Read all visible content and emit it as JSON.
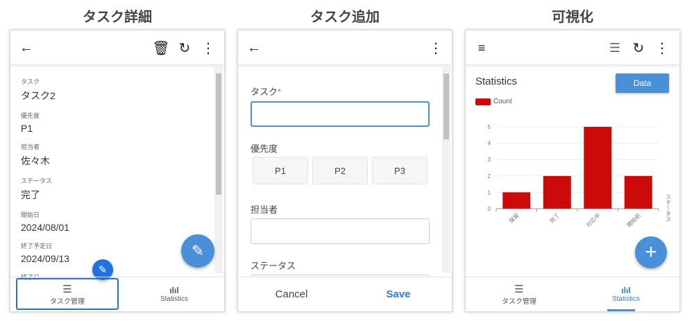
{
  "titles": [
    "タスク詳細",
    "タスク追加",
    "可視化"
  ],
  "detail": {
    "fields": [
      {
        "label": "タスク",
        "value": "タスク2"
      },
      {
        "label": "優先度",
        "value": "P1"
      },
      {
        "label": "担当者",
        "value": "佐々木"
      },
      {
        "label": "ステータス",
        "value": "完了"
      },
      {
        "label": "開始日",
        "value": "2024/08/01"
      },
      {
        "label": "終了予定日",
        "value": "2024/09/13"
      },
      {
        "label": "終了日",
        "value": ""
      }
    ]
  },
  "nav": {
    "tasks": "タスク管理",
    "stats": "Statistics"
  },
  "add": {
    "task_label": "タスク",
    "required": "*",
    "priority_label": "優先度",
    "priorities": [
      "P1",
      "P2",
      "P3"
    ],
    "assignee_label": "担当者",
    "status_label": "ステータス",
    "cancel": "Cancel",
    "save": "Save"
  },
  "stats": {
    "title": "Statistics",
    "data_button": "Data"
  },
  "chart_data": {
    "type": "bar",
    "title": "Statistics",
    "legend": [
      "Count"
    ],
    "legend_position": "top-left",
    "categories": [
      "保留",
      "完了",
      "対応中",
      "開始前"
    ],
    "values": [
      1,
      2,
      5,
      2
    ],
    "xlabel": "ステータス",
    "ylabel": "",
    "ylim": [
      0,
      5
    ],
    "yticks": [
      0,
      1,
      2,
      3,
      4,
      5
    ],
    "grid": true,
    "color": "#cc0a0a"
  }
}
